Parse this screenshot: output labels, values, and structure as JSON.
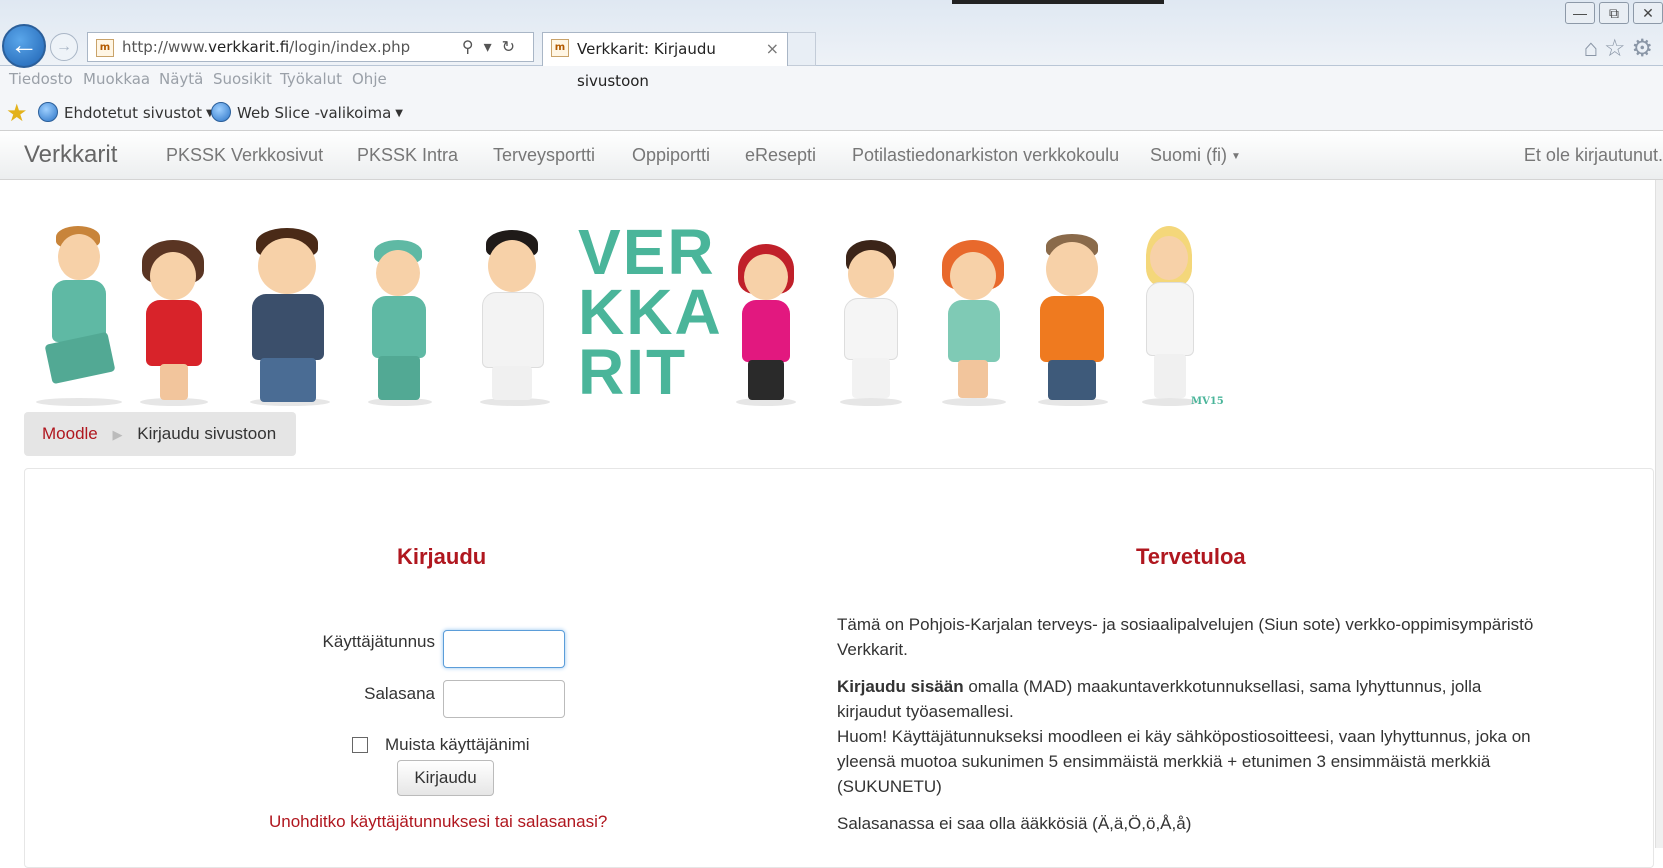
{
  "browser": {
    "url_prefix": "http://www.",
    "url_host": "verkkarit.fi",
    "url_path": "/login/index.php",
    "tab_title": "Verkkarit: Kirjaudu sivustoon",
    "tab_close": "×",
    "menu": [
      "Tiedosto",
      "Muokkaa",
      "Näytä",
      "Suosikit",
      "Työkalut",
      "Ohje"
    ],
    "favorites": [
      "Ehdotetut sivustot",
      "Web Slice -valikoima"
    ]
  },
  "navbar": {
    "brand": "Verkkarit",
    "links": [
      "PKSSK Verkkosivut",
      "PKSSK Intra",
      "Terveysportti",
      "Oppiportti",
      "eResepti",
      "Potilastiedonarkiston verkkokoulu",
      "Suomi (fi)"
    ],
    "status": "Et ole kirjautunut."
  },
  "banner": {
    "logo_lines": [
      "VER",
      "KKA",
      "RIT"
    ],
    "signature": "MV15"
  },
  "breadcrumb": {
    "home": "Moodle",
    "current": "Kirjaudu sivustoon"
  },
  "login": {
    "heading": "Kirjaudu",
    "username_label": "Käyttäjätunnus",
    "password_label": "Salasana",
    "remember_label": "Muista käyttäjänimi",
    "submit_label": "Kirjaudu",
    "forgot_link": "Unohditko käyttäjätunnuksesi tai salasanasi?"
  },
  "welcome": {
    "heading": "Tervetuloa",
    "p1": "Tämä on Pohjois-Karjalan terveys- ja sosiaalipalvelujen (Siun sote) verkko-oppimisympäristö Verkkarit.",
    "p2_bold": "Kirjaudu sisään",
    "p2_rest": " omalla (MAD) maakuntaverkkotunnuksellasi, sama lyhyttunnus, jolla kirjaudut työasemallesi.",
    "p2_note": "Huom! Käyttäjätunnukseksi moodleen ei käy sähköpostiosoitteesi, vaan lyhyttunnus, joka on yleensä muotoa sukunimen 5 ensimmäistä merkkiä + etunimen 3 ensimmäistä merkkiä (SUKUNETU)",
    "p3": "Salasanassa ei saa olla ääkkösiä (Ä,ä,Ö,ö,Å,å)"
  },
  "colors": {
    "accent_red": "#b0171f",
    "logo_green": "#4ab59a"
  }
}
